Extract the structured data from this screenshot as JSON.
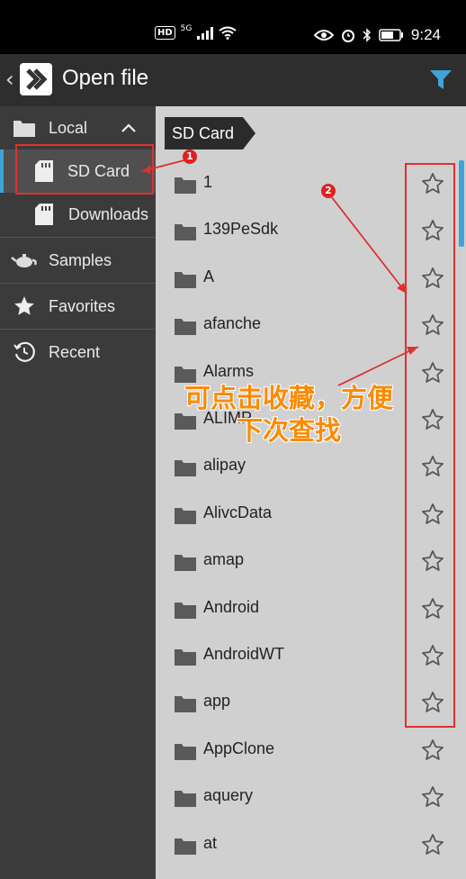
{
  "status_bar": {
    "network": "HD",
    "signal": "5G",
    "time": "9:24"
  },
  "header": {
    "title": "Open file"
  },
  "sidebar": {
    "local": "Local",
    "sd_card": "SD Card",
    "downloads": "Downloads",
    "samples": "Samples",
    "favorites": "Favorites",
    "recent": "Recent"
  },
  "breadcrumb": "SD Card",
  "files": [
    "1",
    "139PeSdk",
    "A",
    "afanche",
    "Alarms",
    "ALIMP",
    "alipay",
    "AlivcData",
    "amap",
    "Android",
    "AndroidWT",
    "app",
    "AppClone",
    "aquery",
    "at"
  ],
  "annotations": {
    "badge1": "1",
    "badge2": "2",
    "note_line1": "可点击收藏，方便",
    "note_line2": "下次查找"
  },
  "colors": {
    "accent": "#3fa3d8",
    "annotation": "#e03030",
    "note": "#ff8a00"
  }
}
